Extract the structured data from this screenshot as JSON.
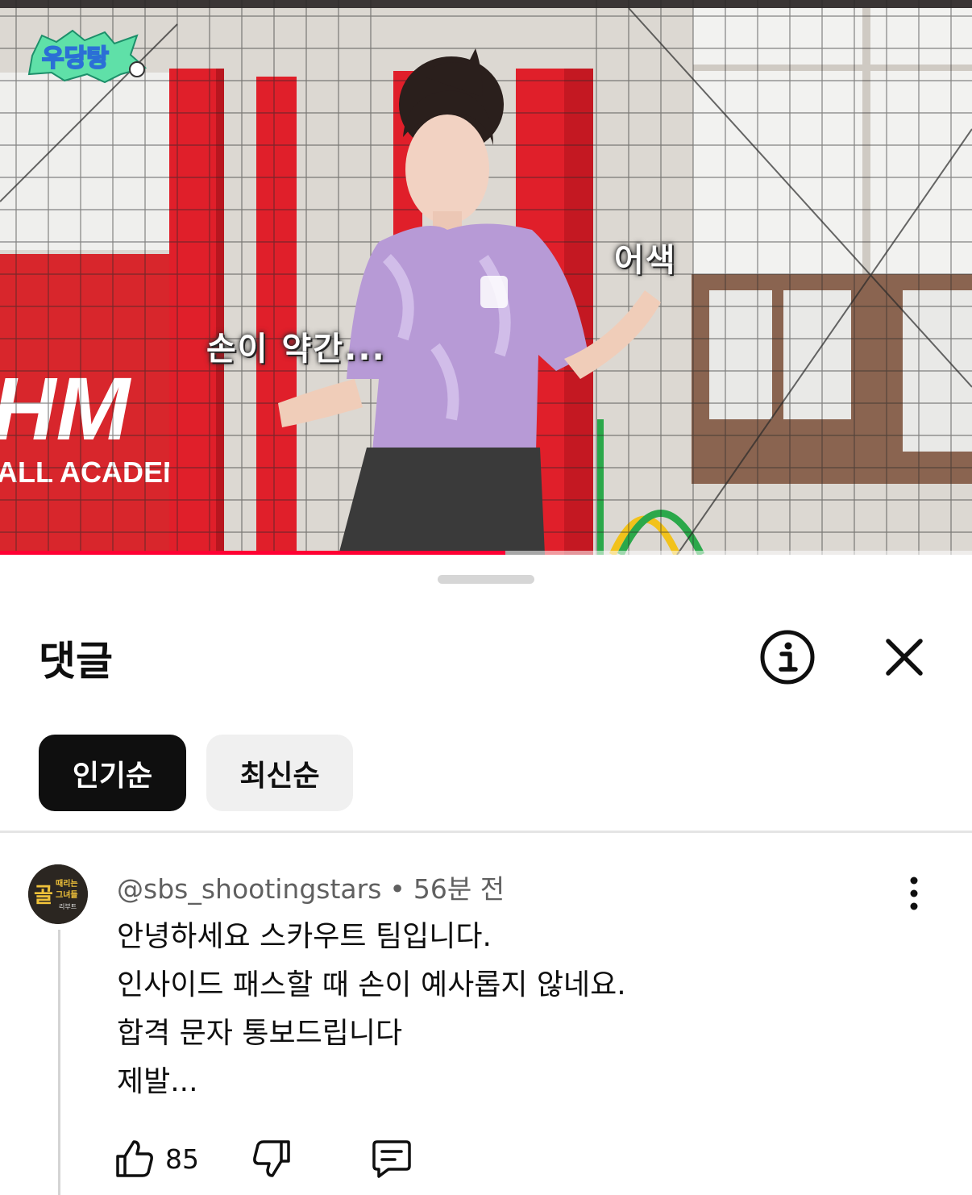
{
  "video": {
    "captions": [
      "손이 약간...",
      "어색"
    ],
    "show_logo_icon": "show-logo-icon",
    "progress": 0.52,
    "progress_color": "#ff0033",
    "background_text": [
      "HM",
      "ALL ACADEM"
    ]
  },
  "sheet": {
    "title": "댓글",
    "info_icon": "info-icon",
    "close_icon": "close-icon",
    "sort_chips": [
      {
        "label": "인기순",
        "active": true
      },
      {
        "label": "최신순",
        "active": false
      }
    ]
  },
  "comment": {
    "author": "@sbs_shootingstars",
    "separator": "•",
    "time": "56분 전",
    "avatar_text": [
      "골",
      "때리는",
      "그녀들",
      "리부트"
    ],
    "lines": [
      "안녕하세요 스카우트 팀입니다.",
      "인사이드 패스할 때 손이 예사롭지 않네요.",
      "합격 문자 통보드립니다",
      "제발..."
    ],
    "like_count": "85",
    "icons": {
      "like": "thumbs-up-icon",
      "dislike": "thumbs-down-icon",
      "reply": "reply-icon",
      "more": "more-vertical-icon"
    }
  },
  "colors": {
    "text": "#0f0f0f",
    "secondary_text": "#606060",
    "chip_active_bg": "#0f0f0f",
    "chip_idle_bg": "#f0f0f0"
  }
}
